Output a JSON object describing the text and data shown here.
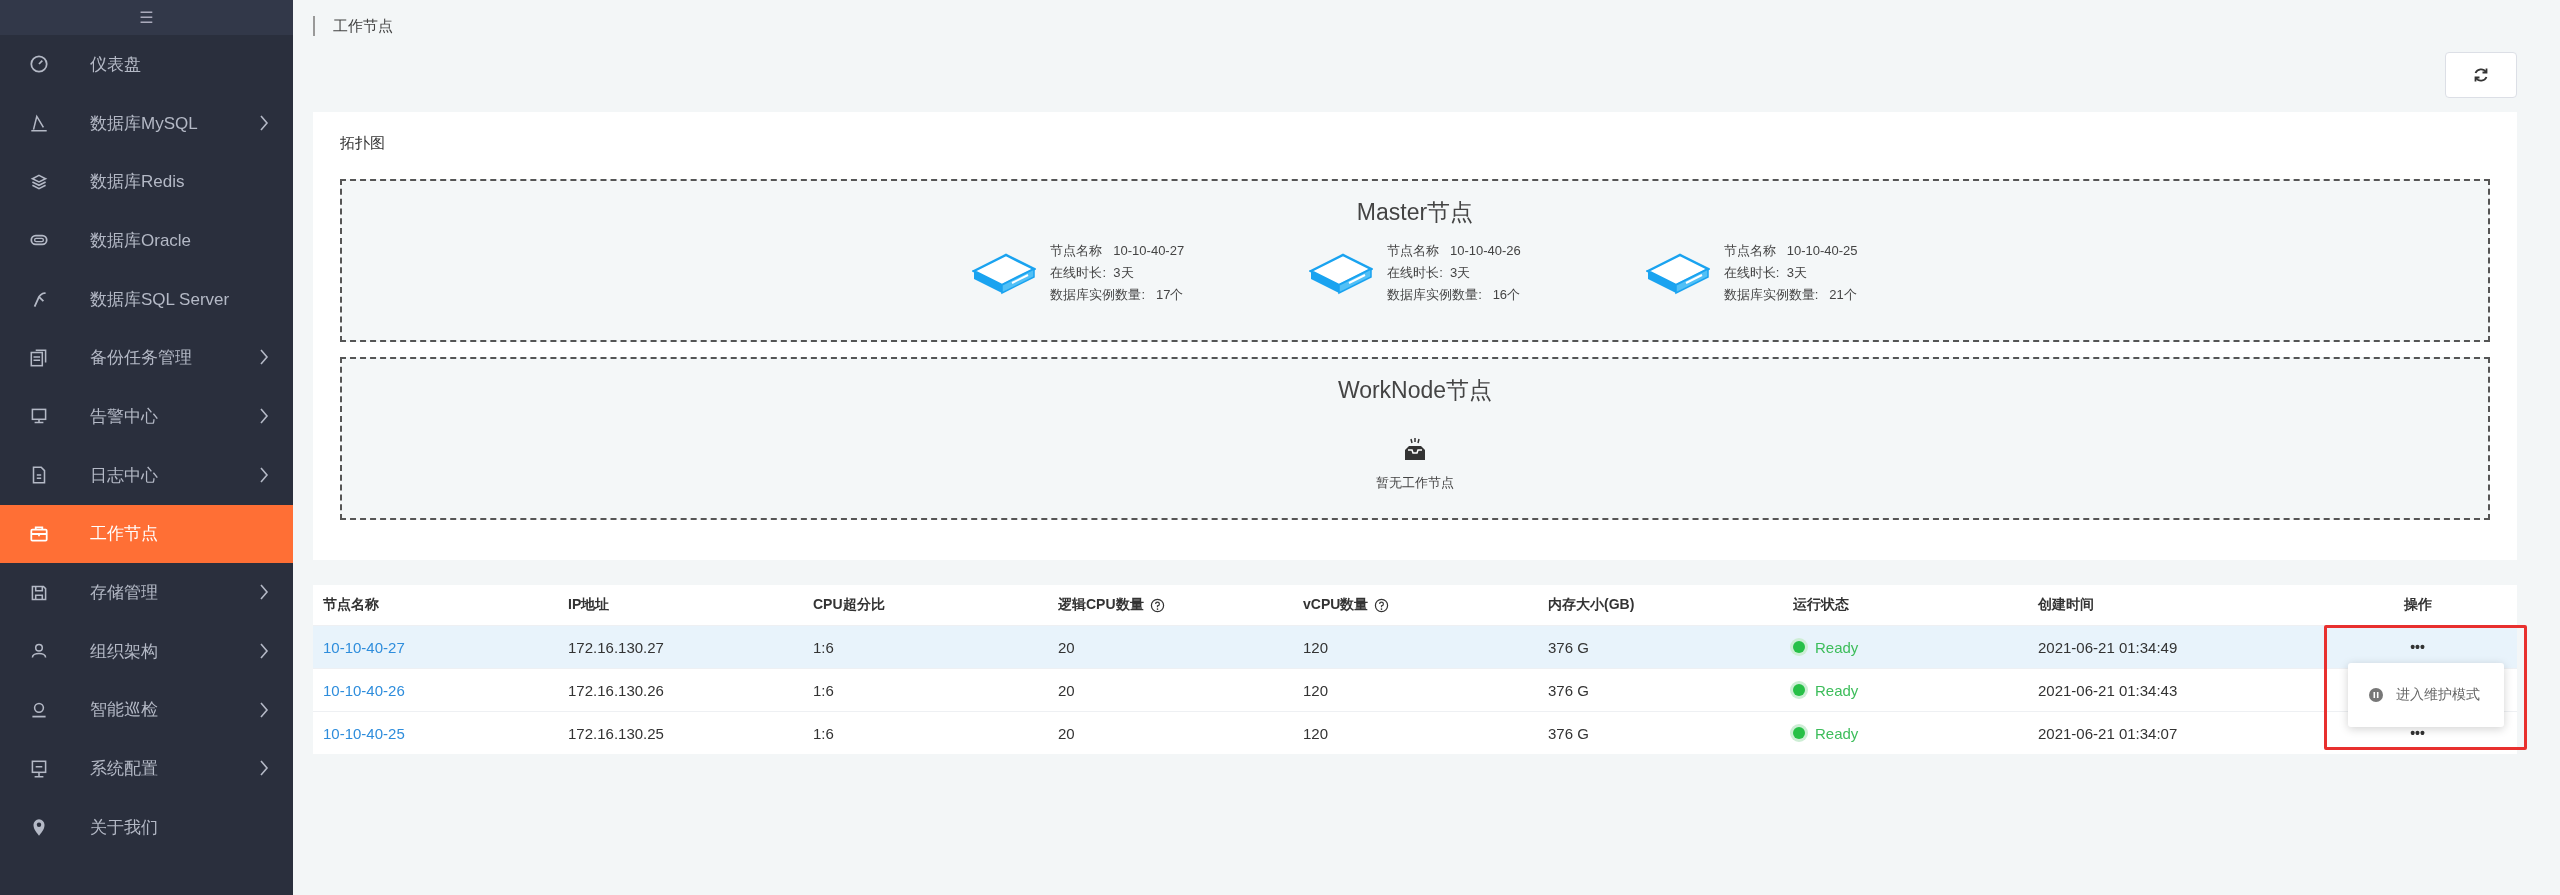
{
  "sidebar": {
    "toggle": "☰",
    "items": [
      {
        "label": "仪表盘",
        "expandable": false,
        "selected": false
      },
      {
        "label": "数据库MySQL",
        "expandable": true,
        "selected": false
      },
      {
        "label": "数据库Redis",
        "expandable": false,
        "selected": false
      },
      {
        "label": "数据库Oracle",
        "expandable": false,
        "selected": false
      },
      {
        "label": "数据库SQL Server",
        "expandable": false,
        "selected": false
      },
      {
        "label": "备份任务管理",
        "expandable": true,
        "selected": false
      },
      {
        "label": "告警中心",
        "expandable": true,
        "selected": false
      },
      {
        "label": "日志中心",
        "expandable": true,
        "selected": false
      },
      {
        "label": "工作节点",
        "expandable": false,
        "selected": true
      },
      {
        "label": "存储管理",
        "expandable": true,
        "selected": false
      },
      {
        "label": "组织架构",
        "expandable": true,
        "selected": false
      },
      {
        "label": "智能巡检",
        "expandable": true,
        "selected": false
      },
      {
        "label": "系统配置",
        "expandable": true,
        "selected": false
      },
      {
        "label": "关于我们",
        "expandable": false,
        "selected": false
      }
    ]
  },
  "breadcrumb": "工作节点",
  "topology": {
    "title": "拓扑图",
    "master": {
      "title": "Master节点",
      "nodes": [
        {
          "name_label": "节点名称",
          "name": "10-10-40-27",
          "uptime_label": "在线时长:",
          "uptime": "3天",
          "instances_label": "数据库实例数量:",
          "instances": "17个"
        },
        {
          "name_label": "节点名称",
          "name": "10-10-40-26",
          "uptime_label": "在线时长:",
          "uptime": "3天",
          "instances_label": "数据库实例数量:",
          "instances": "16个"
        },
        {
          "name_label": "节点名称",
          "name": "10-10-40-25",
          "uptime_label": "在线时长:",
          "uptime": "3天",
          "instances_label": "数据库实例数量:",
          "instances": "21个"
        }
      ]
    },
    "worknode": {
      "title": "WorkNode节点",
      "empty_text": "暂无工作节点"
    }
  },
  "table": {
    "columns": [
      {
        "label": "节点名称",
        "help": false
      },
      {
        "label": "IP地址",
        "help": false
      },
      {
        "label": "CPU超分比",
        "help": false
      },
      {
        "label": "逻辑CPU数量",
        "help": true
      },
      {
        "label": "vCPU数量",
        "help": true
      },
      {
        "label": "内存大小(GB)",
        "help": false
      },
      {
        "label": "运行状态",
        "help": false
      },
      {
        "label": "创建时间",
        "help": false
      },
      {
        "label": "操作",
        "help": false
      }
    ],
    "rows": [
      {
        "name": "10-10-40-27",
        "ip": "172.16.130.27",
        "cpu_ratio": "1:6",
        "logical_cpu": "20",
        "vcpu": "120",
        "memory": "376 G",
        "status": "Ready",
        "created": "2021-06-21 01:34:49",
        "actions": "•••",
        "highlighted": true
      },
      {
        "name": "10-10-40-26",
        "ip": "172.16.130.26",
        "cpu_ratio": "1:6",
        "logical_cpu": "20",
        "vcpu": "120",
        "memory": "376 G",
        "status": "Ready",
        "created": "2021-06-21 01:34:43",
        "highlighted": false
      },
      {
        "name": "10-10-40-25",
        "ip": "172.16.130.25",
        "cpu_ratio": "1:6",
        "logical_cpu": "20",
        "vcpu": "120",
        "memory": "376 G",
        "status": "Ready",
        "created": "2021-06-21 01:34:07",
        "actions": "•••",
        "highlighted": false
      }
    ]
  },
  "action_menu": {
    "items": [
      {
        "label": "进入维护模式"
      }
    ]
  }
}
